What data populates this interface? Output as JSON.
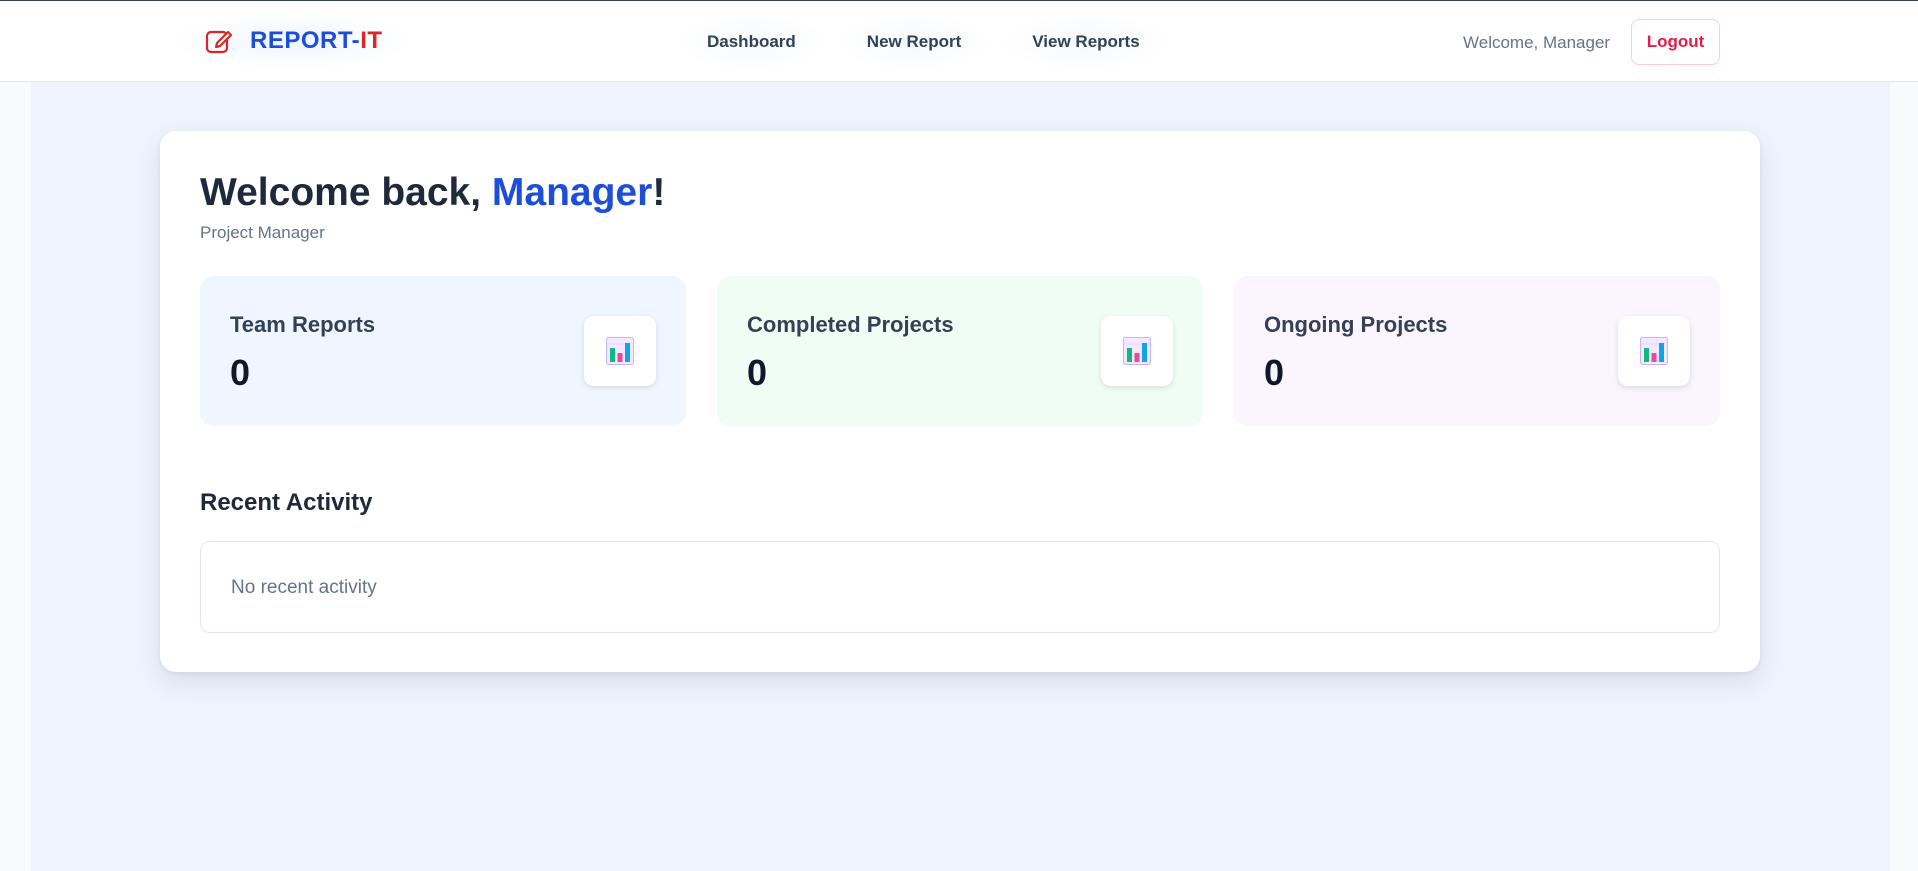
{
  "navbar": {
    "brand": {
      "part1": "REPORT-",
      "part2": "IT",
      "icon": "edit-note-icon"
    },
    "links": [
      {
        "label": "Dashboard"
      },
      {
        "label": "New Report"
      },
      {
        "label": "View Reports"
      }
    ],
    "welcome_text": "Welcome, Manager",
    "logout_label": "Logout"
  },
  "dashboard": {
    "greeting_prefix": "Welcome back, ",
    "greeting_name": "Manager",
    "greeting_suffix": "!",
    "role": "Project Manager",
    "stats": [
      {
        "label": "Team Reports",
        "value": "0",
        "icon": "bar-chart-icon"
      },
      {
        "label": "Completed Projects",
        "value": "0",
        "icon": "bar-chart-icon"
      },
      {
        "label": "Ongoing Projects",
        "value": "0",
        "icon": "bar-chart-icon"
      }
    ],
    "recent_activity": {
      "title": "Recent Activity",
      "empty_text": "No recent activity"
    }
  },
  "colors": {
    "brand_blue": "#1d4ed8",
    "brand_red": "#dc2626",
    "logout_red": "#e11d48",
    "main_background": "#eef3fd"
  }
}
